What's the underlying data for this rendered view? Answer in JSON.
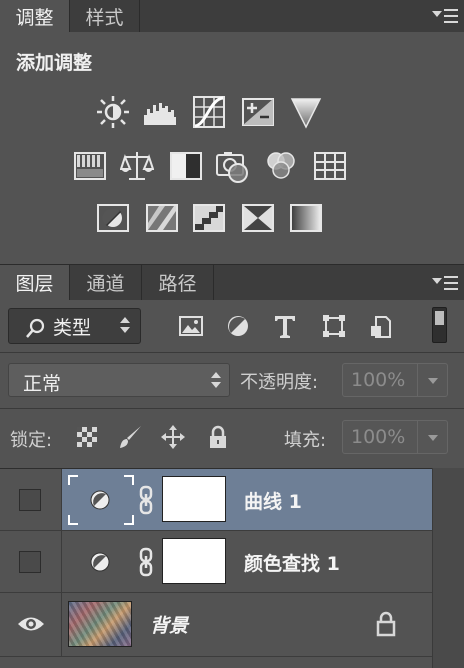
{
  "adjustments_panel": {
    "tabs": [
      {
        "label": "调整",
        "active": true
      },
      {
        "label": "样式",
        "active": false
      }
    ],
    "heading": "添加调整",
    "icons_row1": [
      "brightness-contrast-icon",
      "levels-icon",
      "curves-icon",
      "exposure-icon",
      "vibrance-icon"
    ],
    "icons_row2": [
      "hue-saturation-icon",
      "color-balance-icon",
      "black-white-icon",
      "photo-filter-icon",
      "channel-mixer-icon",
      "color-lookup-icon"
    ],
    "icons_row3": [
      "invert-icon",
      "posterize-icon",
      "threshold-icon",
      "selective-color-icon",
      "gradient-map-icon"
    ]
  },
  "layers_panel": {
    "tabs": [
      {
        "label": "图层",
        "active": true
      },
      {
        "label": "通道",
        "active": false
      },
      {
        "label": "路径",
        "active": false
      }
    ],
    "filter": {
      "kind_label": "类型",
      "filter_icons": [
        "image-filter-icon",
        "adjustment-filter-icon",
        "type-filter-icon",
        "shape-filter-icon",
        "smart-object-filter-icon"
      ]
    },
    "blend_mode": "正常",
    "opacity_label": "不透明度:",
    "opacity_value": "100%",
    "lock_label": "锁定:",
    "fill_label": "填充:",
    "fill_value": "100%",
    "layers": [
      {
        "name": "曲线 1",
        "selected": true,
        "visible": false,
        "type": "adjustment"
      },
      {
        "name": "颜色查找 1",
        "selected": false,
        "visible": false,
        "type": "adjustment"
      },
      {
        "name": "背景",
        "selected": false,
        "visible": true,
        "type": "background",
        "locked": true
      }
    ]
  },
  "colors": {
    "panel_bg": "#535353",
    "tabbar_bg": "#3d3d3d",
    "selected_row": "#6e7f96"
  }
}
